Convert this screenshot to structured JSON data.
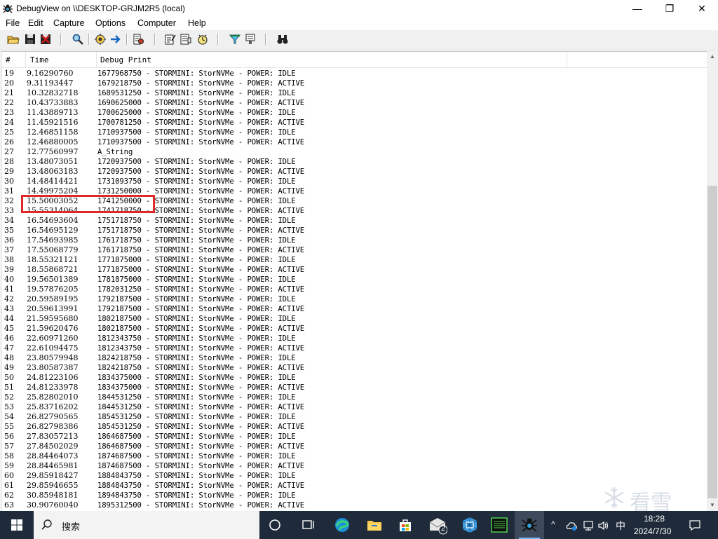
{
  "window": {
    "title": "DebugView on \\\\DESKTOP-GRJM2R5 (local)",
    "minimize": "—",
    "maximize": "❐",
    "close": "✕"
  },
  "menu": [
    "File",
    "Edit",
    "Capture",
    "Options",
    "Computer",
    "Help"
  ],
  "toolbar_icons": [
    "open-icon",
    "save-icon",
    "clear-icon",
    "find-icon",
    "capture-icon",
    "capture-arrow-icon",
    "options-icon",
    "filter-icon",
    "history-icon",
    "timer-icon",
    "highlight-icon",
    "bookmark-icon",
    "binoculars-icon"
  ],
  "columns": {
    "num": "#",
    "time": "Time",
    "print": "Debug Print"
  },
  "rows": [
    {
      "n": "19",
      "t": "9.16290760",
      "p": "1677968750 - STORMINI: StorNVMe - POWER: IDLE"
    },
    {
      "n": "20",
      "t": "9.31193447",
      "p": "1679218750 - STORMINI: StorNVMe - POWER: ACTIVE"
    },
    {
      "n": "21",
      "t": "10.32832718",
      "p": "1689531250 - STORMINI: StorNVMe - POWER: IDLE"
    },
    {
      "n": "22",
      "t": "10.43733883",
      "p": "1690625000 - STORMINI: StorNVMe - POWER: ACTIVE"
    },
    {
      "n": "23",
      "t": "11.43889713",
      "p": "1700625000 - STORMINI: StorNVMe - POWER: IDLE"
    },
    {
      "n": "24",
      "t": "11.45921516",
      "p": "1700781250 - STORMINI: StorNVMe - POWER: ACTIVE"
    },
    {
      "n": "25",
      "t": "12.46851158",
      "p": "1710937500 - STORMINI: StorNVMe - POWER: IDLE"
    },
    {
      "n": "26",
      "t": "12.46880005",
      "p": "1710937500 - STORMINI: StorNVMe - POWER: ACTIVE"
    },
    {
      "n": "27",
      "t": "12.77560997",
      "p": "A_String"
    },
    {
      "n": "28",
      "t": "13.48073051",
      "p": "1720937500 - STORMINI: StorNVMe - POWER: IDLE"
    },
    {
      "n": "29",
      "t": "13.48063183",
      "p": "1720937500 - STORMINI: StorNVMe - POWER: ACTIVE"
    },
    {
      "n": "30",
      "t": "14.48414421",
      "p": "1731093750 - STORMINI: StorNVMe - POWER: IDLE"
    },
    {
      "n": "31",
      "t": "14.49975204",
      "p": "1731250000 - STORMINI: StorNVMe - POWER: ACTIVE"
    },
    {
      "n": "32",
      "t": "15.50003052",
      "p": "1741250000 - STORMINI: StorNVMe - POWER: IDLE"
    },
    {
      "n": "33",
      "t": "15.55314064",
      "p": "1741718750 - STORMINI: StorNVMe - POWER: ACTIVE"
    },
    {
      "n": "34",
      "t": "16.54693604",
      "p": "1751718750 - STORMINI: StorNVMe - POWER: IDLE"
    },
    {
      "n": "35",
      "t": "16.54695129",
      "p": "1751718750 - STORMINI: StorNVMe - POWER: ACTIVE"
    },
    {
      "n": "36",
      "t": "17.54693985",
      "p": "1761718750 - STORMINI: StorNVMe - POWER: IDLE"
    },
    {
      "n": "37",
      "t": "17.55068779",
      "p": "1761718750 - STORMINI: StorNVMe - POWER: ACTIVE"
    },
    {
      "n": "38",
      "t": "18.55321121",
      "p": "1771875000 - STORMINI: StorNVMe - POWER: IDLE"
    },
    {
      "n": "39",
      "t": "18.55868721",
      "p": "1771875000 - STORMINI: StorNVMe - POWER: ACTIVE"
    },
    {
      "n": "40",
      "t": "19.56501389",
      "p": "1781875000 - STORMINI: StorNVMe - POWER: IDLE"
    },
    {
      "n": "41",
      "t": "19.57876205",
      "p": "1782031250 - STORMINI: StorNVMe - POWER: ACTIVE"
    },
    {
      "n": "42",
      "t": "20.59589195",
      "p": "1792187500 - STORMINI: StorNVMe - POWER: IDLE"
    },
    {
      "n": "43",
      "t": "20.59613991",
      "p": "1792187500 - STORMINI: StorNVMe - POWER: ACTIVE"
    },
    {
      "n": "44",
      "t": "21.59595680",
      "p": "1802187500 - STORMINI: StorNVMe - POWER: IDLE"
    },
    {
      "n": "45",
      "t": "21.59620476",
      "p": "1802187500 - STORMINI: StorNVMe - POWER: ACTIVE"
    },
    {
      "n": "46",
      "t": "22.60971260",
      "p": "1812343750 - STORMINI: StorNVMe - POWER: IDLE"
    },
    {
      "n": "47",
      "t": "22.61094475",
      "p": "1812343750 - STORMINI: StorNVMe - POWER: ACTIVE"
    },
    {
      "n": "48",
      "t": "23.80579948",
      "p": "1824218750 - STORMINI: StorNVMe - POWER: IDLE"
    },
    {
      "n": "49",
      "t": "23.80587387",
      "p": "1824218750 - STORMINI: StorNVMe - POWER: ACTIVE"
    },
    {
      "n": "50",
      "t": "24.81223106",
      "p": "1834375000 - STORMINI: StorNVMe - POWER: IDLE"
    },
    {
      "n": "51",
      "t": "24.81233978",
      "p": "1834375000 - STORMINI: StorNVMe - POWER: ACTIVE"
    },
    {
      "n": "52",
      "t": "25.82802010",
      "p": "1844531250 - STORMINI: StorNVMe - POWER: IDLE"
    },
    {
      "n": "53",
      "t": "25.83716202",
      "p": "1844531250 - STORMINI: StorNVMe - POWER: ACTIVE"
    },
    {
      "n": "54",
      "t": "26.82790565",
      "p": "1854531250 - STORMINI: StorNVMe - POWER: IDLE"
    },
    {
      "n": "55",
      "t": "26.82798386",
      "p": "1854531250 - STORMINI: StorNVMe - POWER: ACTIVE"
    },
    {
      "n": "56",
      "t": "27.83057213",
      "p": "1864687500 - STORMINI: StorNVMe - POWER: IDLE"
    },
    {
      "n": "57",
      "t": "27.84502029",
      "p": "1864687500 - STORMINI: StorNVMe - POWER: ACTIVE"
    },
    {
      "n": "58",
      "t": "28.84464073",
      "p": "1874687500 - STORMINI: StorNVMe - POWER: IDLE"
    },
    {
      "n": "59",
      "t": "28.84465981",
      "p": "1874687500 - STORMINI: StorNVMe - POWER: ACTIVE"
    },
    {
      "n": "60",
      "t": "29.85918427",
      "p": "1884843750 - STORMINI: StorNVMe - POWER: IDLE"
    },
    {
      "n": "61",
      "t": "29.85946655",
      "p": "1884843750 - STORMINI: StorNVMe - POWER: ACTIVE"
    },
    {
      "n": "62",
      "t": "30.85948181",
      "p": "1894843750 - STORMINI: StorNVMe - POWER: IDLE"
    },
    {
      "n": "63",
      "t": "30.90760040",
      "p": "1895312500 - STORMINI: StorNVMe - POWER: ACTIVE"
    }
  ],
  "highlight_color": "#e0282a",
  "watermark": "看雪",
  "taskbar": {
    "search_label": "搜索",
    "mail_badge": "2",
    "ime": "中",
    "time": "18:28",
    "date": "2024/7/30"
  }
}
